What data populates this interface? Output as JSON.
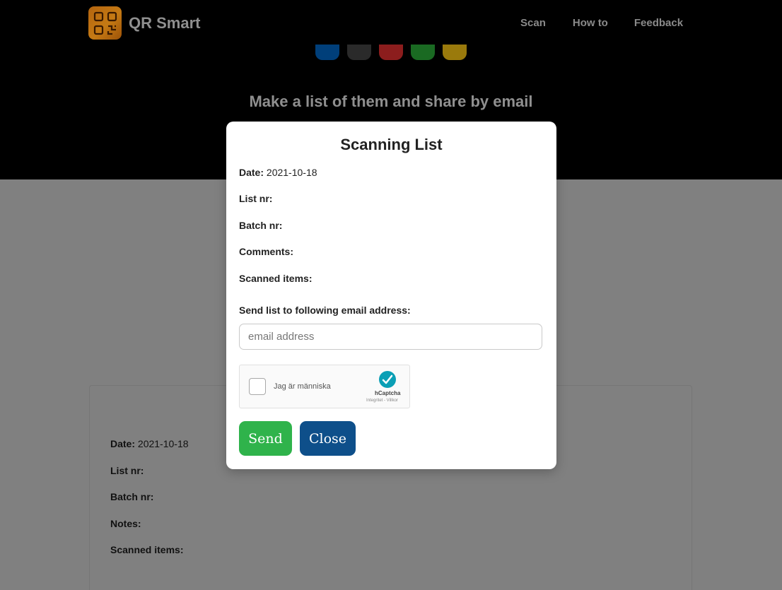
{
  "header": {
    "brand": "QR Smart",
    "nav": [
      "Scan",
      "How to",
      "Feedback"
    ]
  },
  "swatch_colors": [
    "#003f7a",
    "#2a2a2a",
    "#8c1d1d",
    "#1a6a22",
    "#9a7a0c"
  ],
  "hero": {
    "tagline": "Make a list of them and share by email"
  },
  "background_card": {
    "rows": [
      {
        "label": "Date:",
        "value": "2021-10-18"
      },
      {
        "label": "List nr:",
        "value": ""
      },
      {
        "label": "Batch nr:",
        "value": ""
      },
      {
        "label": "Notes:",
        "value": ""
      },
      {
        "label": "Scanned items:",
        "value": ""
      }
    ]
  },
  "modal": {
    "title": "Scanning List",
    "fields": [
      {
        "label": "Date:",
        "value": "2021-10-18"
      },
      {
        "label": "List nr:",
        "value": ""
      },
      {
        "label": "Batch nr:",
        "value": ""
      },
      {
        "label": "Comments:",
        "value": ""
      },
      {
        "label": "Scanned items:",
        "value": ""
      }
    ],
    "send_label": "Send list to following email address:",
    "email_placeholder": "email address",
    "captcha": {
      "label": "Jag är människa",
      "brand": "hCaptcha",
      "links": "Integritet - Villkor"
    },
    "send_button": "Send",
    "close_button": "Close"
  }
}
